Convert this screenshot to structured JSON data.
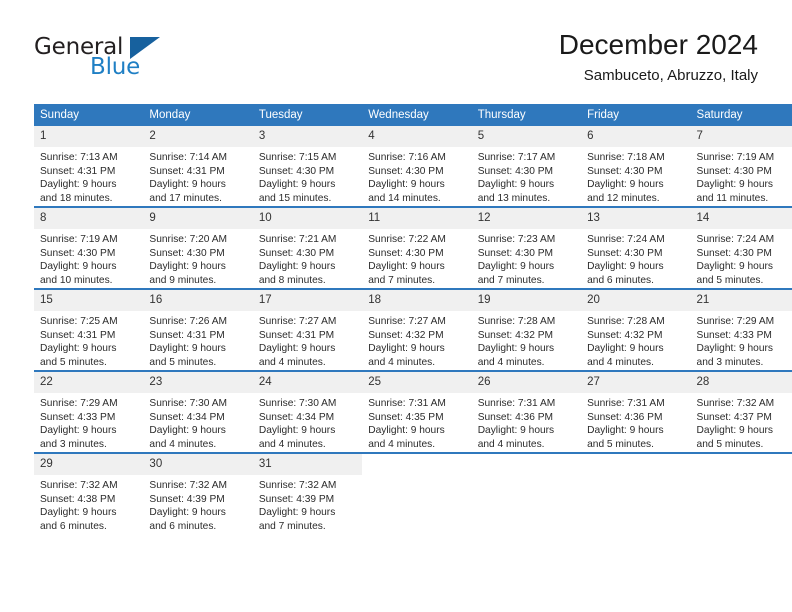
{
  "brand": {
    "name_top": "General",
    "name_bottom": "Blue",
    "accent_color": "#1f7fc4",
    "triangle_color": "#17619e",
    "triangle_icon": "triangle-icon"
  },
  "header": {
    "month_title": "December 2024",
    "location": "Sambuceto, Abruzzo, Italy"
  },
  "calendar": {
    "header_background": "#2f78bd",
    "daynum_background": "#f0f0f0",
    "weekday_headers": [
      "Sunday",
      "Monday",
      "Tuesday",
      "Wednesday",
      "Thursday",
      "Friday",
      "Saturday"
    ],
    "weeks": [
      [
        {
          "day": "1",
          "sunrise": "Sunrise: 7:13 AM",
          "sunset": "Sunset: 4:31 PM",
          "daylight_line1": "Daylight: 9 hours",
          "daylight_line2": "and 18 minutes."
        },
        {
          "day": "2",
          "sunrise": "Sunrise: 7:14 AM",
          "sunset": "Sunset: 4:31 PM",
          "daylight_line1": "Daylight: 9 hours",
          "daylight_line2": "and 17 minutes."
        },
        {
          "day": "3",
          "sunrise": "Sunrise: 7:15 AM",
          "sunset": "Sunset: 4:30 PM",
          "daylight_line1": "Daylight: 9 hours",
          "daylight_line2": "and 15 minutes."
        },
        {
          "day": "4",
          "sunrise": "Sunrise: 7:16 AM",
          "sunset": "Sunset: 4:30 PM",
          "daylight_line1": "Daylight: 9 hours",
          "daylight_line2": "and 14 minutes."
        },
        {
          "day": "5",
          "sunrise": "Sunrise: 7:17 AM",
          "sunset": "Sunset: 4:30 PM",
          "daylight_line1": "Daylight: 9 hours",
          "daylight_line2": "and 13 minutes."
        },
        {
          "day": "6",
          "sunrise": "Sunrise: 7:18 AM",
          "sunset": "Sunset: 4:30 PM",
          "daylight_line1": "Daylight: 9 hours",
          "daylight_line2": "and 12 minutes."
        },
        {
          "day": "7",
          "sunrise": "Sunrise: 7:19 AM",
          "sunset": "Sunset: 4:30 PM",
          "daylight_line1": "Daylight: 9 hours",
          "daylight_line2": "and 11 minutes."
        }
      ],
      [
        {
          "day": "8",
          "sunrise": "Sunrise: 7:19 AM",
          "sunset": "Sunset: 4:30 PM",
          "daylight_line1": "Daylight: 9 hours",
          "daylight_line2": "and 10 minutes."
        },
        {
          "day": "9",
          "sunrise": "Sunrise: 7:20 AM",
          "sunset": "Sunset: 4:30 PM",
          "daylight_line1": "Daylight: 9 hours",
          "daylight_line2": "and 9 minutes."
        },
        {
          "day": "10",
          "sunrise": "Sunrise: 7:21 AM",
          "sunset": "Sunset: 4:30 PM",
          "daylight_line1": "Daylight: 9 hours",
          "daylight_line2": "and 8 minutes."
        },
        {
          "day": "11",
          "sunrise": "Sunrise: 7:22 AM",
          "sunset": "Sunset: 4:30 PM",
          "daylight_line1": "Daylight: 9 hours",
          "daylight_line2": "and 7 minutes."
        },
        {
          "day": "12",
          "sunrise": "Sunrise: 7:23 AM",
          "sunset": "Sunset: 4:30 PM",
          "daylight_line1": "Daylight: 9 hours",
          "daylight_line2": "and 7 minutes."
        },
        {
          "day": "13",
          "sunrise": "Sunrise: 7:24 AM",
          "sunset": "Sunset: 4:30 PM",
          "daylight_line1": "Daylight: 9 hours",
          "daylight_line2": "and 6 minutes."
        },
        {
          "day": "14",
          "sunrise": "Sunrise: 7:24 AM",
          "sunset": "Sunset: 4:30 PM",
          "daylight_line1": "Daylight: 9 hours",
          "daylight_line2": "and 5 minutes."
        }
      ],
      [
        {
          "day": "15",
          "sunrise": "Sunrise: 7:25 AM",
          "sunset": "Sunset: 4:31 PM",
          "daylight_line1": "Daylight: 9 hours",
          "daylight_line2": "and 5 minutes."
        },
        {
          "day": "16",
          "sunrise": "Sunrise: 7:26 AM",
          "sunset": "Sunset: 4:31 PM",
          "daylight_line1": "Daylight: 9 hours",
          "daylight_line2": "and 5 minutes."
        },
        {
          "day": "17",
          "sunrise": "Sunrise: 7:27 AM",
          "sunset": "Sunset: 4:31 PM",
          "daylight_line1": "Daylight: 9 hours",
          "daylight_line2": "and 4 minutes."
        },
        {
          "day": "18",
          "sunrise": "Sunrise: 7:27 AM",
          "sunset": "Sunset: 4:32 PM",
          "daylight_line1": "Daylight: 9 hours",
          "daylight_line2": "and 4 minutes."
        },
        {
          "day": "19",
          "sunrise": "Sunrise: 7:28 AM",
          "sunset": "Sunset: 4:32 PM",
          "daylight_line1": "Daylight: 9 hours",
          "daylight_line2": "and 4 minutes."
        },
        {
          "day": "20",
          "sunrise": "Sunrise: 7:28 AM",
          "sunset": "Sunset: 4:32 PM",
          "daylight_line1": "Daylight: 9 hours",
          "daylight_line2": "and 4 minutes."
        },
        {
          "day": "21",
          "sunrise": "Sunrise: 7:29 AM",
          "sunset": "Sunset: 4:33 PM",
          "daylight_line1": "Daylight: 9 hours",
          "daylight_line2": "and 3 minutes."
        }
      ],
      [
        {
          "day": "22",
          "sunrise": "Sunrise: 7:29 AM",
          "sunset": "Sunset: 4:33 PM",
          "daylight_line1": "Daylight: 9 hours",
          "daylight_line2": "and 3 minutes."
        },
        {
          "day": "23",
          "sunrise": "Sunrise: 7:30 AM",
          "sunset": "Sunset: 4:34 PM",
          "daylight_line1": "Daylight: 9 hours",
          "daylight_line2": "and 4 minutes."
        },
        {
          "day": "24",
          "sunrise": "Sunrise: 7:30 AM",
          "sunset": "Sunset: 4:34 PM",
          "daylight_line1": "Daylight: 9 hours",
          "daylight_line2": "and 4 minutes."
        },
        {
          "day": "25",
          "sunrise": "Sunrise: 7:31 AM",
          "sunset": "Sunset: 4:35 PM",
          "daylight_line1": "Daylight: 9 hours",
          "daylight_line2": "and 4 minutes."
        },
        {
          "day": "26",
          "sunrise": "Sunrise: 7:31 AM",
          "sunset": "Sunset: 4:36 PM",
          "daylight_line1": "Daylight: 9 hours",
          "daylight_line2": "and 4 minutes."
        },
        {
          "day": "27",
          "sunrise": "Sunrise: 7:31 AM",
          "sunset": "Sunset: 4:36 PM",
          "daylight_line1": "Daylight: 9 hours",
          "daylight_line2": "and 5 minutes."
        },
        {
          "day": "28",
          "sunrise": "Sunrise: 7:32 AM",
          "sunset": "Sunset: 4:37 PM",
          "daylight_line1": "Daylight: 9 hours",
          "daylight_line2": "and 5 minutes."
        }
      ],
      [
        {
          "day": "29",
          "sunrise": "Sunrise: 7:32 AM",
          "sunset": "Sunset: 4:38 PM",
          "daylight_line1": "Daylight: 9 hours",
          "daylight_line2": "and 6 minutes."
        },
        {
          "day": "30",
          "sunrise": "Sunrise: 7:32 AM",
          "sunset": "Sunset: 4:39 PM",
          "daylight_line1": "Daylight: 9 hours",
          "daylight_line2": "and 6 minutes."
        },
        {
          "day": "31",
          "sunrise": "Sunrise: 7:32 AM",
          "sunset": "Sunset: 4:39 PM",
          "daylight_line1": "Daylight: 9 hours",
          "daylight_line2": "and 7 minutes."
        },
        null,
        null,
        null,
        null
      ]
    ]
  }
}
